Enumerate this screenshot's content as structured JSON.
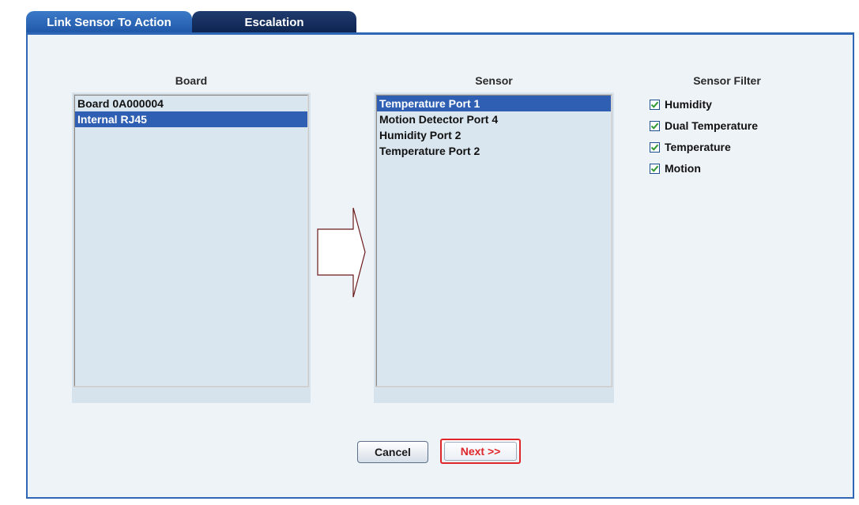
{
  "tabs": [
    {
      "label": "Link Sensor To Action",
      "active": true
    },
    {
      "label": "Escalation",
      "active": false
    }
  ],
  "board": {
    "title": "Board",
    "items": [
      "Board 0A000004",
      "Internal RJ45"
    ],
    "selected": "Internal RJ45"
  },
  "sensor": {
    "title": "Sensor",
    "items": [
      "Temperature Port 1",
      "Motion Detector Port 4",
      "Humidity Port 2",
      "Temperature Port 2"
    ],
    "selected": "Temperature Port 1"
  },
  "filter": {
    "title": "Sensor Filter",
    "items": [
      {
        "label": "Humidity",
        "checked": true
      },
      {
        "label": "Dual Temperature",
        "checked": true
      },
      {
        "label": "Temperature",
        "checked": true
      },
      {
        "label": "Motion",
        "checked": true
      }
    ]
  },
  "buttons": {
    "cancel": "Cancel",
    "next": "Next >>"
  },
  "icons": {
    "arrow": "right-arrow-icon",
    "check": "checkmark-icon"
  },
  "colors": {
    "tab_active": "#2f66b5",
    "tab_inactive": "#0d2450",
    "selection": "#2f5fb3",
    "next_accent": "#e0262a",
    "check_green": "#2f9a2f"
  }
}
